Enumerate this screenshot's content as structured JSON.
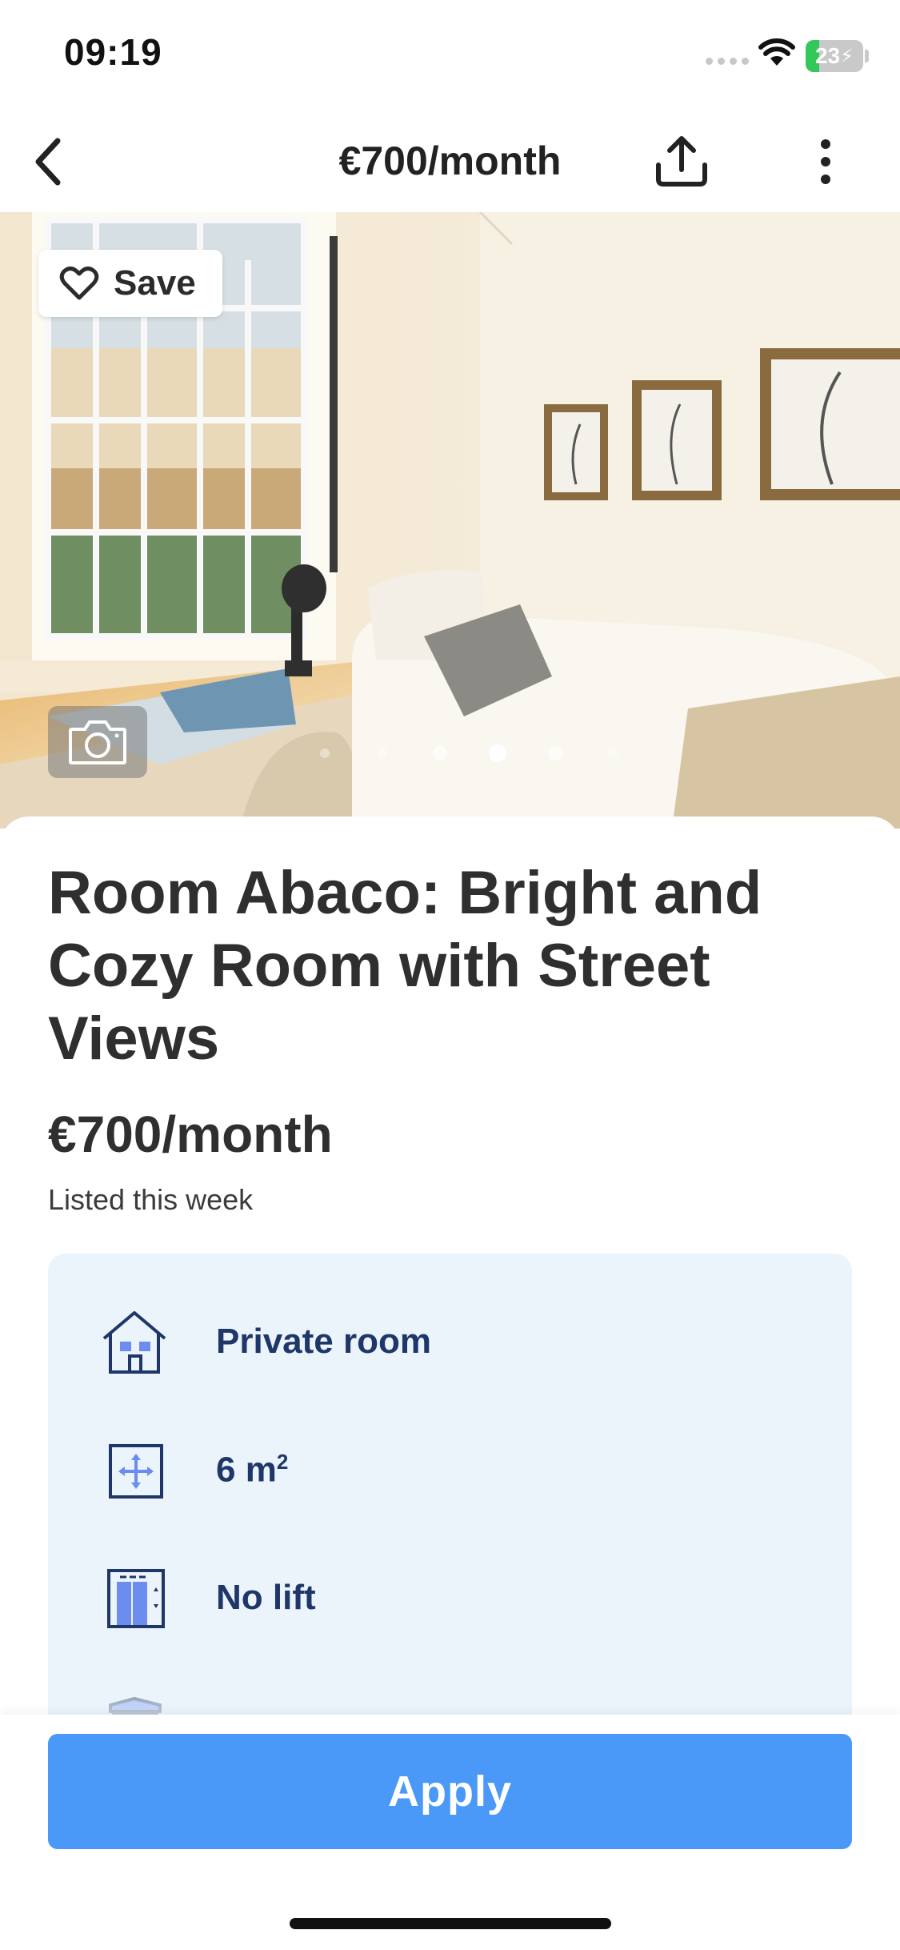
{
  "status_bar": {
    "time": "09:19",
    "battery_level": "23",
    "battery_percent": 23,
    "icons": [
      "cellular-signal-icon",
      "wifi-icon",
      "battery-charging-icon"
    ]
  },
  "nav": {
    "title": "€700/month",
    "back_icon": "chevron-left-icon",
    "share_icon": "share-upload-icon",
    "more_icon": "vertical-ellipsis-icon"
  },
  "gallery": {
    "save_label": "Save",
    "save_icon": "heart-outline-icon",
    "photos_icon": "camera-icon",
    "dot_count": 6,
    "active_dot": 3
  },
  "listing": {
    "title": "Room Abaco: Bright and Cozy Room with Street Views",
    "price": "€700/month",
    "listed": "Listed this week"
  },
  "features": [
    {
      "icon": "house-icon",
      "label": "Private room"
    },
    {
      "icon": "area-arrows-icon",
      "label": "6 m",
      "superscript": "2"
    },
    {
      "icon": "elevator-icon",
      "label": "No lift"
    },
    {
      "icon": "balcony-icon",
      "label": ""
    }
  ],
  "cta": {
    "apply_label": "Apply"
  },
  "colors": {
    "primary": "#4a98f7",
    "feature_text": "#1f3668",
    "feature_bg": "#ebf4fb",
    "icon_accent": "#6c8cf0",
    "battery_green": "#34c759"
  }
}
